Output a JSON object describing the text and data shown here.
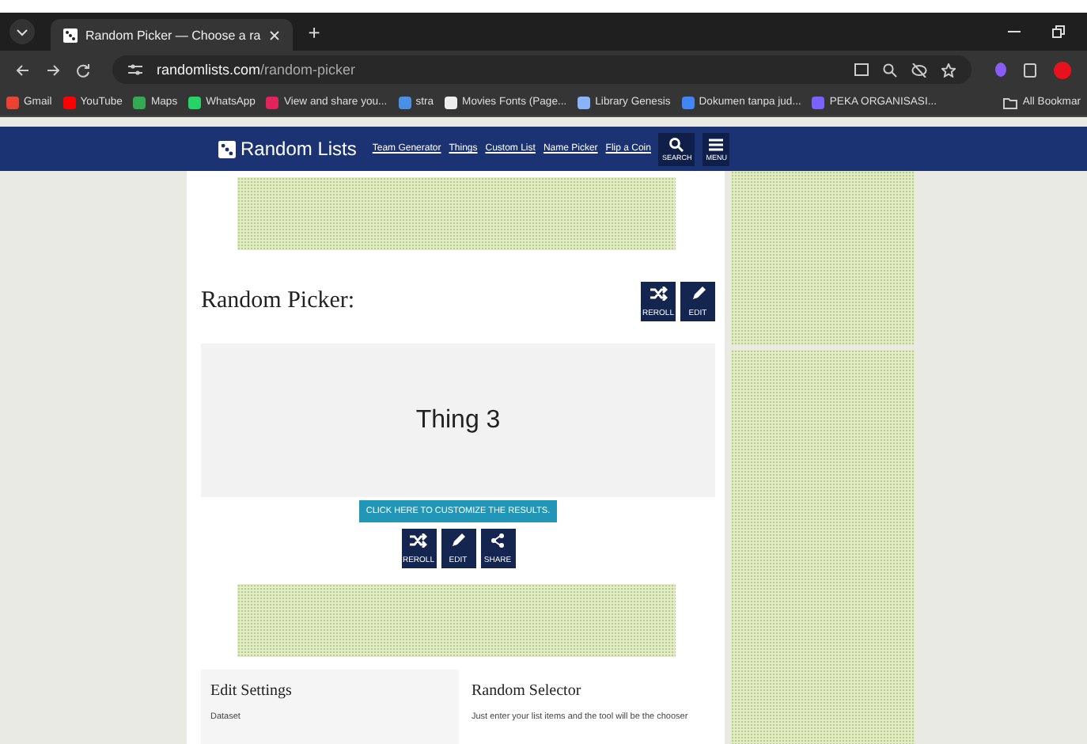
{
  "browser": {
    "tabs": [
      {
        "title": "Random Picker — Choose a ra",
        "selected": true
      }
    ],
    "new_tab": "+",
    "url": {
      "host": "randomlists.com",
      "path": "/random-picker"
    },
    "bookmarks": [
      {
        "label": "Gmail",
        "color": "#ea4335"
      },
      {
        "label": "YouTube",
        "color": "#ff0000"
      },
      {
        "label": "Maps",
        "color": "#34a853"
      },
      {
        "label": "WhatsApp",
        "color": "#25d366"
      },
      {
        "label": "View and share you...",
        "color": "#e0245e"
      },
      {
        "label": "stra",
        "color": "#4a90e2"
      },
      {
        "label": "Movies Fonts (Page...",
        "color": "#eeeeee"
      },
      {
        "label": "Library Genesis",
        "color": "#8ab4f8"
      },
      {
        "label": "Dokumen tanpa jud...",
        "color": "#4285f4"
      },
      {
        "label": "PEKA ORGANISASI...",
        "color": "#7b61ff"
      }
    ],
    "all_bookmarks": "All Bookmar"
  },
  "site": {
    "logo": "Random Lists",
    "nav": [
      "Team Generator",
      "Things",
      "Custom List",
      "Name Picker",
      "Flip a Coin"
    ],
    "search_label": "SEARCH",
    "menu_label": "MENU"
  },
  "picker": {
    "title": "Random Picker:",
    "top_buttons": [
      {
        "kind": "reroll",
        "label": "REROLL"
      },
      {
        "kind": "edit",
        "label": "EDIT"
      }
    ],
    "result": "Thing 3",
    "customize": "CLICK HERE TO CUSTOMIZE THE RESULTS.",
    "buttons": [
      {
        "kind": "reroll",
        "label": "REROLL"
      },
      {
        "kind": "edit",
        "label": "EDIT"
      },
      {
        "kind": "share",
        "label": "SHARE"
      }
    ]
  },
  "settings": {
    "title": "Edit Settings",
    "field_label": "Dataset"
  },
  "about": {
    "title": "Random Selector",
    "text": "Just enter your list items and the tool will be the chooser"
  }
}
